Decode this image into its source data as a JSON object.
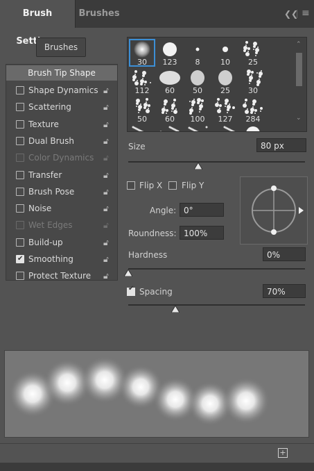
{
  "header": {
    "tab_active": "Brush Settings",
    "tab_inactive": "Brushes",
    "collapse_icon": "double-chevron-left-icon",
    "menu_icon": "hamburger-menu-icon"
  },
  "brushes_button": "Brushes",
  "tip_shape": "Brush Tip Shape",
  "options": [
    {
      "label": "Shape Dynamics",
      "checked": false,
      "enabled": true
    },
    {
      "label": "Scattering",
      "checked": false,
      "enabled": true
    },
    {
      "label": "Texture",
      "checked": false,
      "enabled": true
    },
    {
      "label": "Dual Brush",
      "checked": false,
      "enabled": true
    },
    {
      "label": "Color Dynamics",
      "checked": false,
      "enabled": false
    },
    {
      "label": "Transfer",
      "checked": false,
      "enabled": true
    },
    {
      "label": "Brush Pose",
      "checked": false,
      "enabled": true
    },
    {
      "label": "Noise",
      "checked": false,
      "enabled": true
    },
    {
      "label": "Wet Edges",
      "checked": false,
      "enabled": false
    },
    {
      "label": "Build-up",
      "checked": false,
      "enabled": true
    },
    {
      "label": "Smoothing",
      "checked": true,
      "enabled": true
    },
    {
      "label": "Protect Texture",
      "checked": false,
      "enabled": true
    }
  ],
  "brush_sizes": [
    "30",
    "123",
    "8",
    "10",
    "25",
    "112",
    "60",
    "50",
    "25",
    "30",
    "50",
    "60",
    "100",
    "127",
    "284"
  ],
  "size": {
    "label": "Size",
    "value": "80 px",
    "fraction": 0.5
  },
  "flip_x": "Flip X",
  "flip_y": "Flip Y",
  "angle": {
    "label": "Angle:",
    "value": "0°"
  },
  "roundness": {
    "label": "Roundness:",
    "value": "100%"
  },
  "hardness": {
    "label": "Hardness",
    "value": "0%",
    "fraction": 0.0
  },
  "spacing": {
    "label": "Spacing",
    "value": "70%",
    "checked": true,
    "fraction": 0.34
  },
  "footer_icon": "new-preset-icon",
  "colors": {
    "accent": "#3c8fd6",
    "panel": "#535353",
    "header": "#3b3b3b"
  }
}
